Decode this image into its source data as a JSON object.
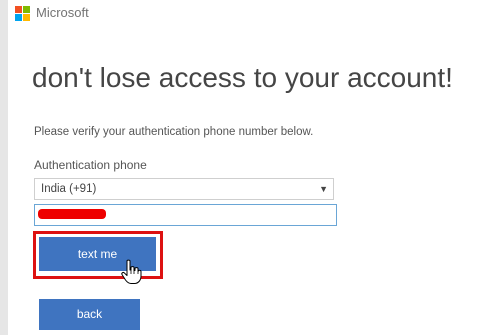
{
  "header": {
    "brand_name": "Microsoft",
    "logo_colors": [
      "#f25022",
      "#7fba00",
      "#00a4ef",
      "#ffb900"
    ]
  },
  "page": {
    "title": "don't lose access to your account!",
    "instruction": "Please verify your authentication phone number below."
  },
  "form": {
    "phone_label": "Authentication phone",
    "country_selected": "India (+91)",
    "phone_value_redacted": true
  },
  "buttons": {
    "text_me_label": "text me",
    "back_label": "back"
  },
  "colors": {
    "button_blue": "#3f74c0",
    "highlight_red": "#dd1111",
    "redaction_red": "#ee0000"
  },
  "icons": {
    "cursor": "hand-pointer-icon",
    "select_arrow": "caret-down-icon"
  }
}
